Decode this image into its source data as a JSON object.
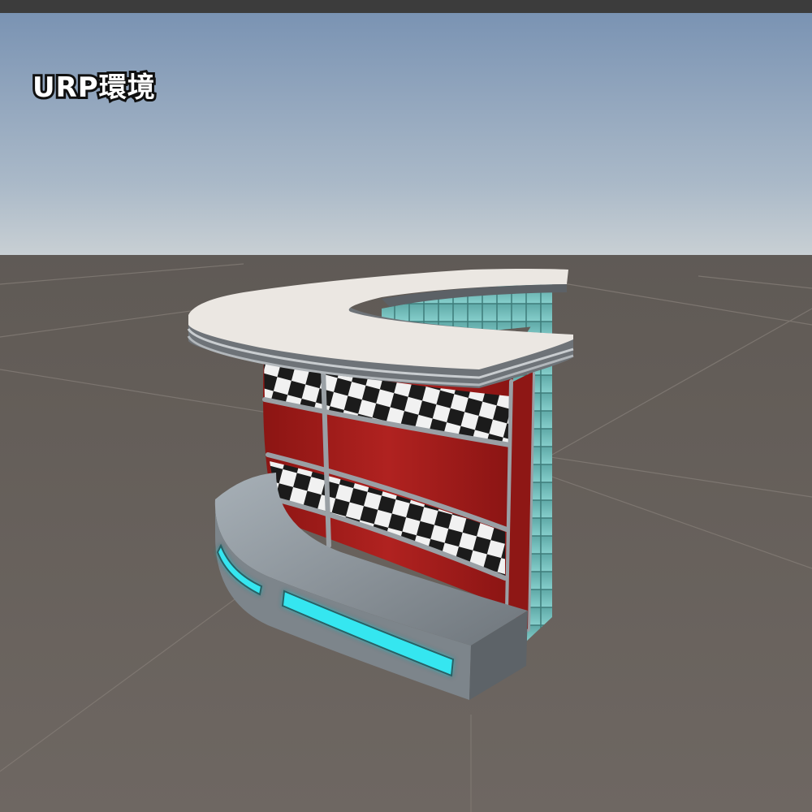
{
  "caption": {
    "text": "URP環境",
    "text_color": "#ffffff",
    "outline_color": "#111111"
  },
  "viewport": {
    "sky_top_color": "#7a93b3",
    "sky_horizon_color": "#c2ccd3",
    "ground_color": "#6b6560",
    "grid_line_color": "#807a74"
  },
  "model": {
    "roof_color": "#ebe7e2",
    "wall_color": "#a51d1c",
    "checker_dark": "#1b1b1b",
    "checker_light": "#f1f1f1",
    "tile_color": "#7cc8c6",
    "base_color": "#8e959c",
    "neon_color": "#35e6f0"
  }
}
